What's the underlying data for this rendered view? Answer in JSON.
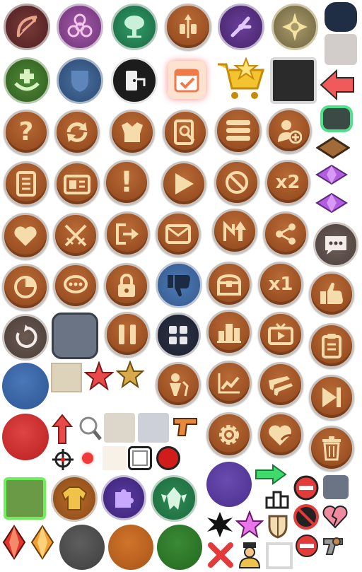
{
  "sheet": {
    "background": "#ffffff"
  },
  "colors": {
    "bronze": "#9a4f22",
    "bronze_light": "#b86a36",
    "cream": "#f3d8a6",
    "rim": "#c9c2bc",
    "maroon": "#6b2c2c",
    "purple": "#7a4a9b",
    "green": "#2f8a55",
    "navy": "#1f2d45",
    "blue": "#3f6aa8",
    "red": "#d42b2b",
    "dark_grey": "#5a5a5a",
    "slate": "#6b7485",
    "gold": "#d8a94a"
  },
  "labels": {
    "question_mark": "?",
    "exclamation_mark": "!",
    "speed_x2": "x2",
    "speed_x1": "x1"
  },
  "icons": [
    "bow-arrow-icon",
    "biohazard-icon",
    "tree-icon",
    "spear-shield-icon",
    "mechanical-claw-icon",
    "sun-emblem-icon",
    "heal-hands-icon",
    "shield-icon",
    "exit-door-icon",
    "calendar-check-icon",
    "shopping-cart-star-icon",
    "question-icon",
    "refresh-icon",
    "armor-icon",
    "profile-search-icon",
    "menu-icon",
    "add-user-icon",
    "notes-icon",
    "id-card-icon",
    "exclamation-icon",
    "play-icon",
    "forbidden-icon",
    "speed-x2-icon",
    "heart-icon",
    "crossed-swords-icon",
    "logout-icon",
    "mail-icon",
    "level-up-icon",
    "share-icon",
    "pie-chart-icon",
    "chat-icon",
    "lock-icon",
    "thumbs-down-icon",
    "treasure-chest-icon",
    "speed-x1-icon",
    "replay-icon",
    "pause-icon",
    "grid-icon",
    "leaderboard-icon",
    "tv-video-icon",
    "gender-icon",
    "stats-chart-icon",
    "rifles-icon",
    "pistol-icon",
    "gear-icon",
    "heart-share-icon",
    "thumbs-up-icon",
    "clipboard-icon",
    "skip-next-icon",
    "trash-icon",
    "arrow-left-icon",
    "arrow-up-icon",
    "arrow-right-icon",
    "magnifier-icon",
    "crosshair-icon",
    "star-icon",
    "gem-icon",
    "puzzle-icon",
    "jacket-icon",
    "crest-icon",
    "no-ads-icon",
    "broken-heart-icon",
    "revolver-icon",
    "no-entry-icon",
    "podium-icon",
    "shield-badge-icon",
    "officer-icon",
    "close-x-icon"
  ]
}
